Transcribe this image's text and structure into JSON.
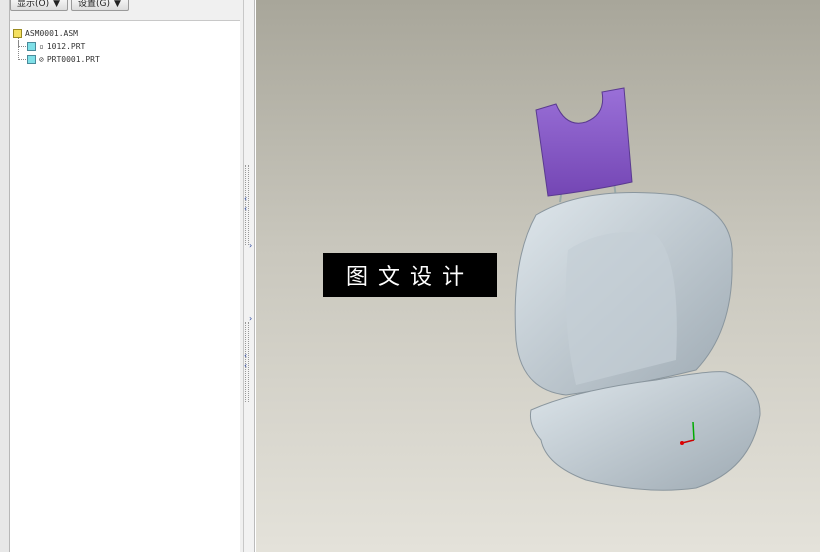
{
  "toolbar": {
    "display_label": "显示(O)",
    "settings_label": "设置(G)",
    "dropdown_arrow": "▼"
  },
  "tree": {
    "root": "ASM0001.ASM",
    "children": [
      "1012.PRT",
      "PRT0001.PRT"
    ]
  },
  "viewport": {
    "watermark": "图文设计"
  },
  "colors": {
    "headrest": "#8a5cc8",
    "seat": "#b8c4cc"
  }
}
